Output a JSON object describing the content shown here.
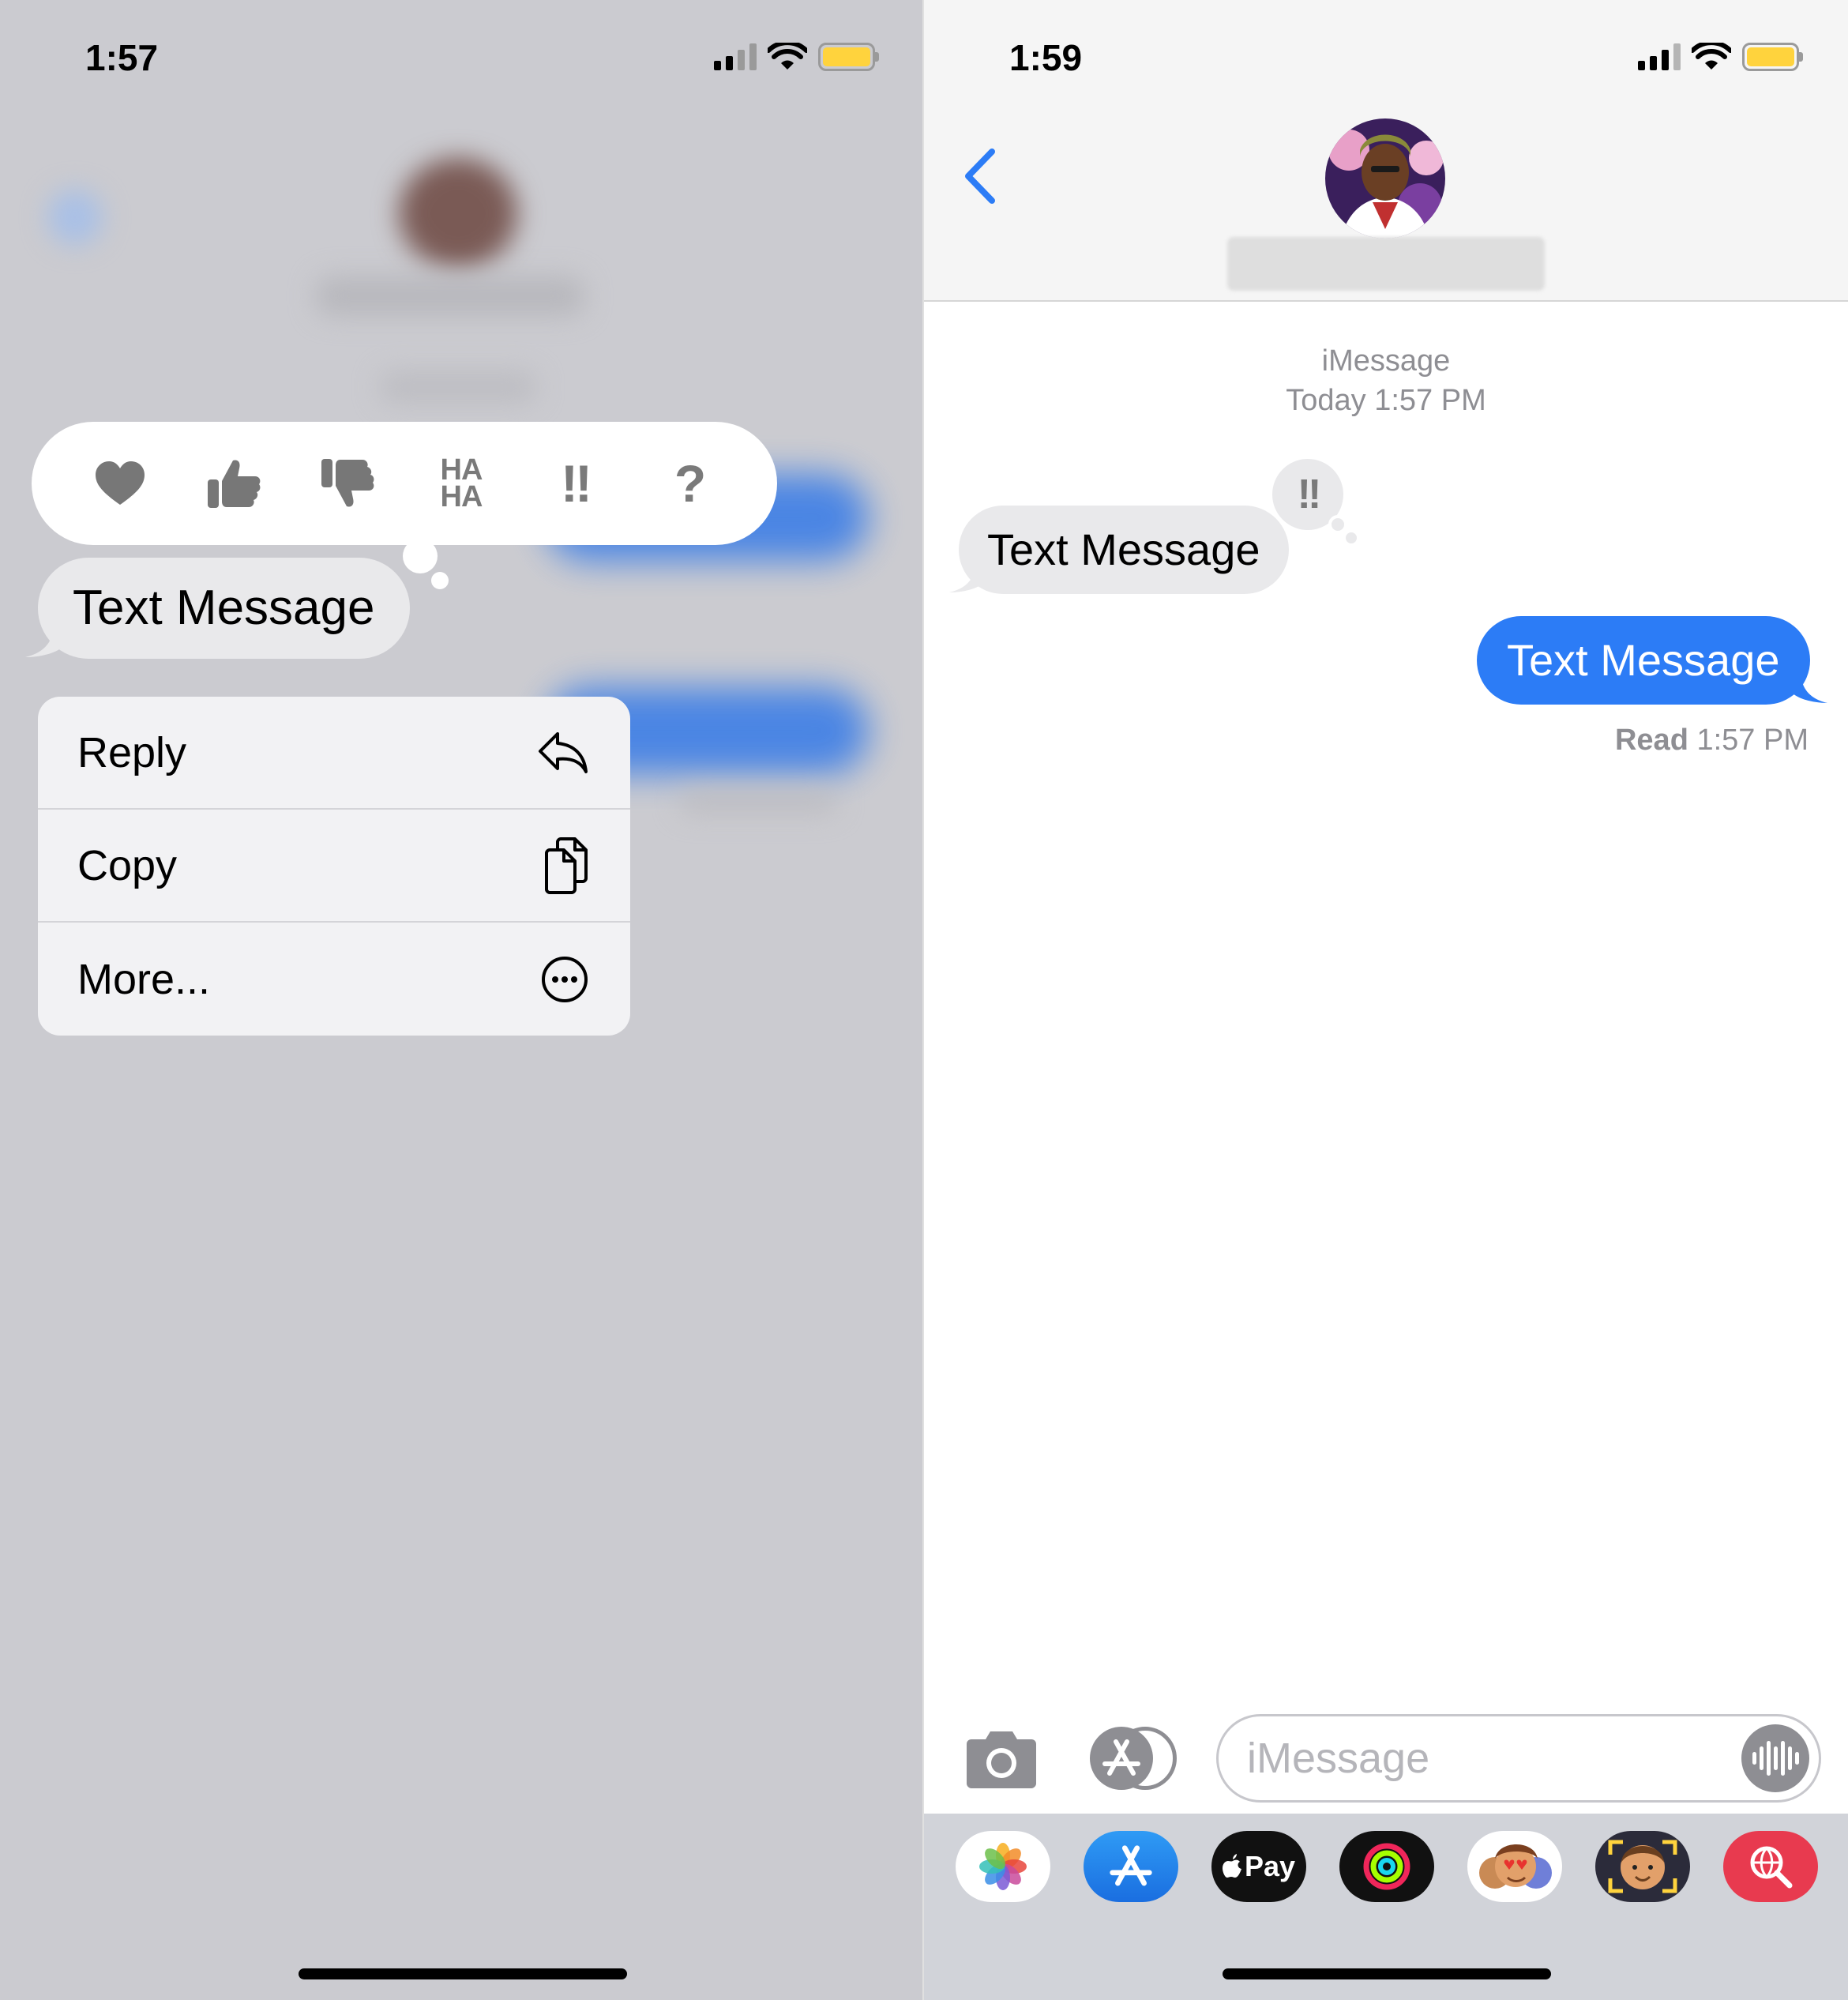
{
  "left": {
    "status": {
      "time": "1:57"
    },
    "tapbacks": [
      "heart",
      "thumbs-up",
      "thumbs-down",
      "haha",
      "emphasize",
      "question"
    ],
    "tapback_text": {
      "haha_top": "HA",
      "haha_bottom": "HA",
      "emphasize": "!!",
      "question": "?"
    },
    "bubble_text": "Text Message",
    "menu": [
      {
        "label": "Reply",
        "icon": "reply-icon"
      },
      {
        "label": "Copy",
        "icon": "copy-icon"
      },
      {
        "label": "More...",
        "icon": "more-icon"
      }
    ]
  },
  "right": {
    "status": {
      "time": "1:59"
    },
    "header": {
      "back_icon": "chevron-left-icon"
    },
    "thread_meta": {
      "service": "iMessage",
      "timestamp": "Today 1:57 PM"
    },
    "received": {
      "text": "Text Message",
      "reaction": "!!"
    },
    "sent": {
      "text": "Text Message"
    },
    "read_receipt": {
      "label": "Read",
      "time": "1:57 PM"
    },
    "input": {
      "placeholder": "iMessage"
    },
    "apps": [
      "photos",
      "app-store",
      "apple-pay",
      "activity",
      "memoji-stickers",
      "animoji",
      "web-images"
    ],
    "apple_pay_label": "Pay"
  },
  "colors": {
    "accent": "#2c7cf6",
    "received_bubble": "#e9e9eb",
    "battery": "#ffd33d",
    "drawer_bg": "#d1d3d9"
  }
}
